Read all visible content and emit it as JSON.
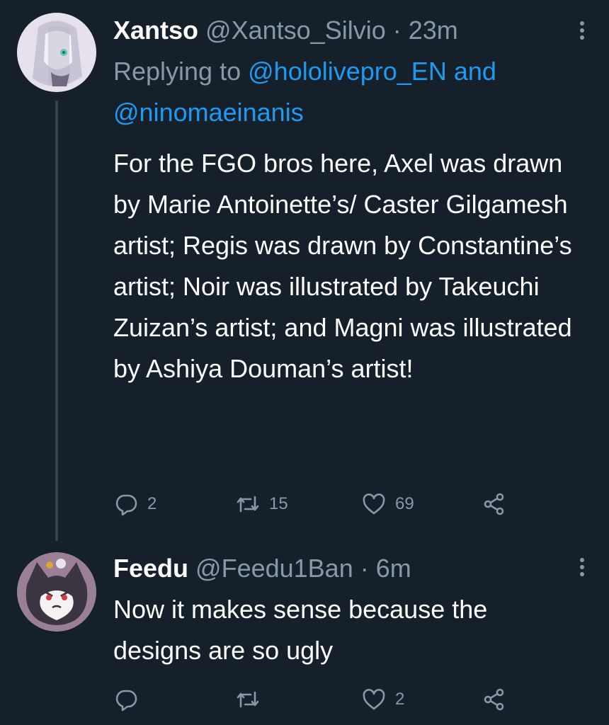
{
  "tweets": [
    {
      "name": "Xantso",
      "handle": "@Xantso_Silvio",
      "separator": "·",
      "time": "23m",
      "replying_prefix": "Replying to",
      "reply_mention_1": "@hololivepro_EN",
      "reply_and": "and",
      "reply_mention_2": "@ninomaeinanis",
      "text": "For the FGO bros here, Axel was drawn by Marie Antoinette’s/ Caster Gilgamesh artist; Regis was drawn by Constantine’s artist; Noir was illustrated by Takeuchi Zuizan’s artist; and Magni was illustrated by Ashiya Douman’s artist!",
      "replies": "2",
      "retweets": "15",
      "likes": "69"
    },
    {
      "name": "Feedu",
      "handle": "@Feedu1Ban",
      "separator": "·",
      "time": "6m",
      "text": "Now it makes sense because the designs are so ugly",
      "replies": "",
      "retweets": "",
      "likes": "2"
    }
  ],
  "icons": {
    "reply": "reply-icon",
    "retweet": "retweet-icon",
    "like": "heart-icon",
    "share": "share-icon",
    "more": "more-vertical-icon"
  },
  "colors": {
    "background": "#15202b",
    "text": "#ffffff",
    "secondary": "#8899a6",
    "link": "#1d9bf0",
    "thread_line": "#38444d"
  }
}
